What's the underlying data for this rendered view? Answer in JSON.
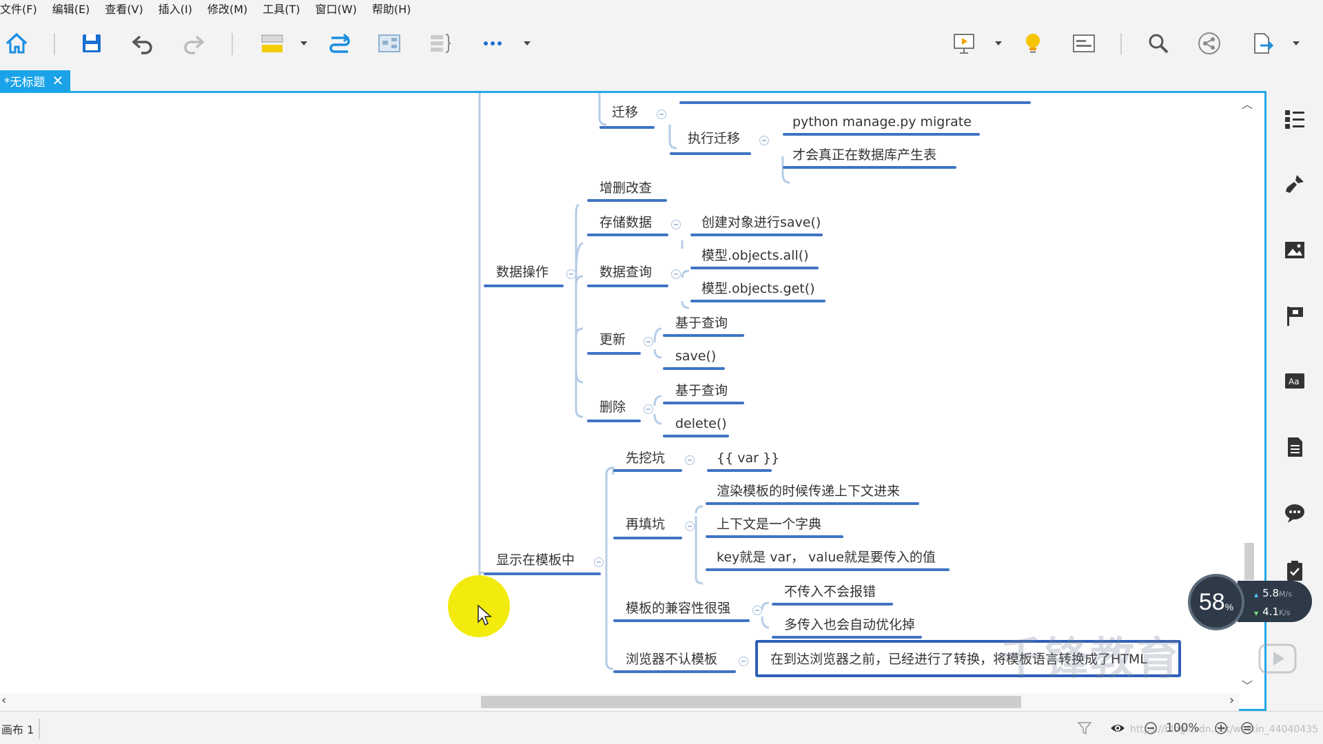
{
  "menu": [
    "文件(F)",
    "编辑(E)",
    "查看(V)",
    "插入(I)",
    "修改(M)",
    "工具(T)",
    "窗口(W)",
    "帮助(H)"
  ],
  "toolbar": {
    "icons": [
      "home-icon",
      "save-icon",
      "undo-icon",
      "redo-icon",
      "topic-style-icon",
      "relationship-icon",
      "boundary-icon",
      "summary-icon",
      "more-icon",
      "presentation-icon",
      "idea-icon",
      "outline-icon",
      "search-icon",
      "share-icon",
      "export-icon"
    ]
  },
  "tab": {
    "title": "*无标题",
    "close": "✕"
  },
  "mindmap": {
    "migrate": "迁移",
    "run_migrate": "执行迁移",
    "run_migrate_cmd": "python manage.py migrate",
    "run_migrate_note": "才会真正在数据库产生表",
    "data_ops": "数据操作",
    "crud": "增删改查",
    "store": "存储数据",
    "store_detail": "创建对象进行save()",
    "query": "数据查询",
    "query_all": "模型.objects.all()",
    "query_get": "模型.objects.get()",
    "update": "更新",
    "update_query": "基于查询",
    "update_save": "save()",
    "delete": "删除",
    "delete_query": "基于查询",
    "delete_call": "delete()",
    "show_template": "显示在模板中",
    "dig_hole": "先挖坑",
    "dig_var": "{{ var }}",
    "fill_hole": "再填坑",
    "fill_1": "渲染模板的时候传递上下文进来",
    "fill_2": "上下文是一个字典",
    "fill_3": "key就是 var， value就是要传入的值",
    "compat": "模板的兼容性很强",
    "compat_1": "不传入不会报错",
    "compat_2": "多传入也会自动优化掉",
    "browser": "浏览器不认模板",
    "browser_1": "在到达浏览器之前，已经进行了转换，将模板语言转换成了HTML"
  },
  "statusbar": {
    "sheet": "画布 1",
    "zoom": "100%"
  },
  "speed": {
    "percent": "58",
    "percent_unit": "%",
    "up": "5.8",
    "up_unit": "M/s",
    "down": "4.1",
    "down_unit": "K/s"
  },
  "watermark": "千锋教育",
  "watermark_url": "https://blog.csdn.net/weixin_44040435",
  "colors": {
    "accent": "#23a7e8",
    "branch_line": "#b6cce6",
    "node_underline": "#3f74c4",
    "highlight": "#f2ea00"
  }
}
